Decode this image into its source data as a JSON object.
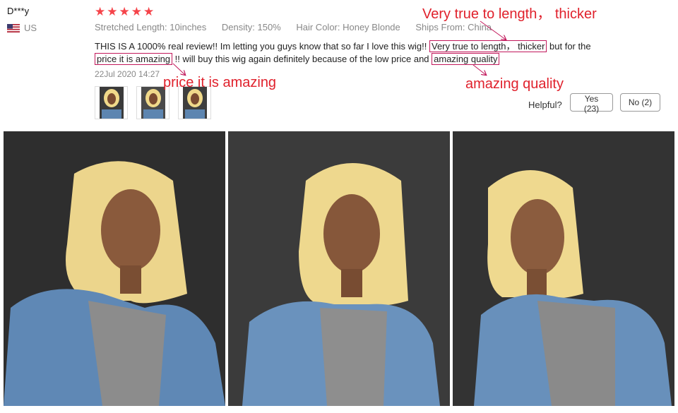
{
  "review": {
    "reviewer": "D***y",
    "country": "US",
    "rating_stars": 5,
    "attributes": {
      "length": "Stretched Length: 10inches",
      "density": "Density: 150%",
      "color": "Hair Color: Honey Blonde",
      "ships": "Ships From: China"
    },
    "text": {
      "part1": "THIS IS A 1000% real review!! Im letting you guys know that so far I love this wig!! ",
      "highlight1": "Very true to length， thicker",
      "part2": " but for the ",
      "highlight2": "price it is amazing",
      "part3": " !! will buy this wig again definitely because of the low price and ",
      "highlight3": "amazing quality"
    },
    "date": "22Jul 2020 14:27",
    "helpful_label": "Helpful?",
    "yes_label": "Yes (23)",
    "no_label": "No (2)"
  },
  "annotations": {
    "top": "Very true to length， thicker",
    "left": "price it is amazing",
    "right": "amazing quality"
  },
  "colors": {
    "star": "#f5444a",
    "annotation": "#e0212c",
    "highlight_border": "#c2185b"
  }
}
